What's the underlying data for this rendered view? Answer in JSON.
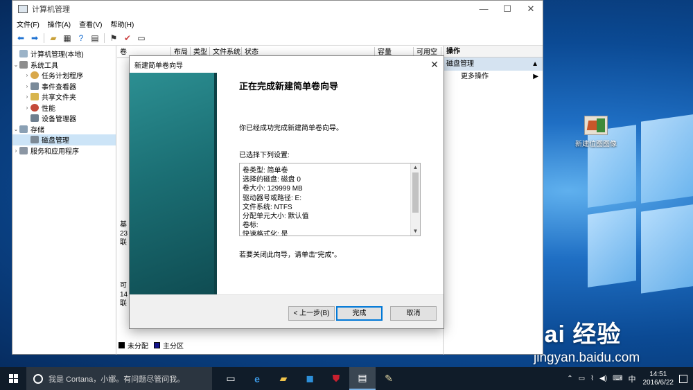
{
  "window": {
    "title": "计算机管理",
    "minimize": "—",
    "maximize": "☐",
    "close": "✕"
  },
  "menu": [
    "文件(F)",
    "操作(A)",
    "查看(V)",
    "帮助(H)"
  ],
  "tree": {
    "root": "计算机管理(本地)",
    "system_tools": "系统工具",
    "task_scheduler": "任务计划程序",
    "event_viewer": "事件查看器",
    "shared_folders": "共享文件夹",
    "performance": "性能",
    "device_manager": "设备管理器",
    "storage": "存储",
    "disk_management": "磁盘管理",
    "services_apps": "服务和应用程序"
  },
  "columns": [
    "卷",
    "布局",
    "类型",
    "文件系统",
    "状态",
    "容量",
    "可用空"
  ],
  "disk_labels": {
    "d0_line1": "基",
    "d0_line2": "23",
    "d0_line3": "联",
    "d1_line1": "可",
    "d1_line2": "14",
    "d1_line3": "联"
  },
  "legend": {
    "unallocated": "未分配",
    "primary": "主分区"
  },
  "actions": {
    "header": "操作",
    "section": "磁盘管理",
    "more": "更多操作"
  },
  "wizard": {
    "title": "新建简单卷向导",
    "close": "✕",
    "heading": "正在完成新建简单卷向导",
    "intro": "你已经成功完成新建简单卷向导。",
    "settings_label": "已选择下列设置:",
    "settings": [
      "卷类型: 简单卷",
      "选择的磁盘: 磁盘 0",
      "卷大小: 129999 MB",
      "驱动器号或路径: E:",
      "文件系统: NTFS",
      "分配单元大小: 默认值",
      "卷标:",
      "快速格式化: 是"
    ],
    "finish_hint": "若要关闭此向导，请单击\"完成\"。",
    "back_button": "< 上一步(B)",
    "finish_button": "完成",
    "cancel_button": "取消"
  },
  "desktop": {
    "icon_label": "新建位图图像",
    "watermark_main": "Bai 经验",
    "watermark_sub": "jingyan.baidu.com"
  },
  "taskbar": {
    "search_text": "我是 Cortana，小娜。有问题尽管问我。",
    "ime": "中",
    "time": "14:51",
    "date": "2016/6/22"
  },
  "colors": {
    "wizard_banner": "#1b6f74",
    "selection": "#cce4f7",
    "taskbar": "#101c29",
    "default_button_border": "#0078d7"
  }
}
